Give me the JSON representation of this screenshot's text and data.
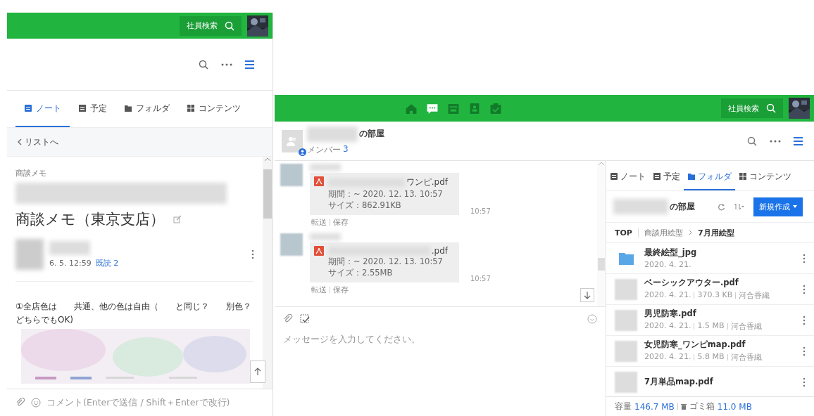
{
  "left_app": {
    "header": {
      "search_label": "社員検索"
    },
    "tabs": [
      {
        "label": "ノート",
        "selected": true
      },
      {
        "label": "予定",
        "selected": false
      },
      {
        "label": "フォルダ",
        "selected": false
      },
      {
        "label": "コンテンツ",
        "selected": false
      }
    ],
    "back_link": "リストへ",
    "note": {
      "category": "商談メモ",
      "title": "商談メモ（東京支店）",
      "date": "6. 5. 12:59",
      "read_label": "既読 2",
      "body": "①全店色は　　共通、他の色は自由（　　と同じ？　　別色？どちらでもOK)"
    },
    "comment": {
      "placeholder": "コメント(Enterで送信 / Shift＋Enterで改行)"
    }
  },
  "right_app": {
    "header": {
      "search_label": "社員検索",
      "nav": [
        {
          "selected": false
        },
        {
          "selected": true
        },
        {
          "selected": false
        },
        {
          "selected": false
        },
        {
          "selected": false
        }
      ]
    },
    "room": {
      "name_suffix": "の部屋",
      "members_label": "メンバー",
      "members_count": "3"
    },
    "messages": [
      {
        "file_name": "ワンピ.pdf",
        "period": "期間：~ 2020. 12. 13. 10:57",
        "size": "サイズ：862.91KB",
        "time": "10:57",
        "actions": [
          "転送",
          "保存"
        ]
      },
      {
        "file_name": ".pdf",
        "period": "期間：~ 2020. 12. 13. 10:57",
        "size": "サイズ：2.55MB",
        "time": "10:57",
        "actions": [
          "転送",
          "保存"
        ]
      }
    ],
    "composer": {
      "placeholder": "メッセージを入力してください。"
    },
    "sidebar": {
      "tabs": [
        {
          "label": "ノート",
          "selected": false
        },
        {
          "label": "予定",
          "selected": false
        },
        {
          "label": "フォルダ",
          "selected": true
        },
        {
          "label": "コンテンツ",
          "selected": false
        }
      ],
      "folder_suffix": "の部屋",
      "new_button": "新規作成",
      "breadcrumb": [
        "TOP",
        "商談用絵型",
        "7月用絵型"
      ],
      "files": [
        {
          "kind": "folder",
          "name": "最終絵型_jpg",
          "meta": [
            "2020. 4. 21."
          ]
        },
        {
          "kind": "file",
          "name": "ベーシックアウター.pdf",
          "meta": [
            "2020. 4. 21.",
            "370.3 KB",
            "河合香織"
          ]
        },
        {
          "kind": "file",
          "name": "男児防寒.pdf",
          "meta": [
            "2020. 4. 21.",
            "1.5 MB",
            "河合香織"
          ]
        },
        {
          "kind": "file",
          "name": "女児防寒_ワンピmap.pdf",
          "meta": [
            "2020. 4. 21.",
            "5.8 MB",
            "河合香織"
          ]
        },
        {
          "kind": "file",
          "name": "7月単品map.pdf"
        }
      ],
      "storage_label": "容量",
      "storage_value": "146.7 MB",
      "trash_label": "ゴミ箱",
      "trash_value": "11.0 MB"
    }
  }
}
